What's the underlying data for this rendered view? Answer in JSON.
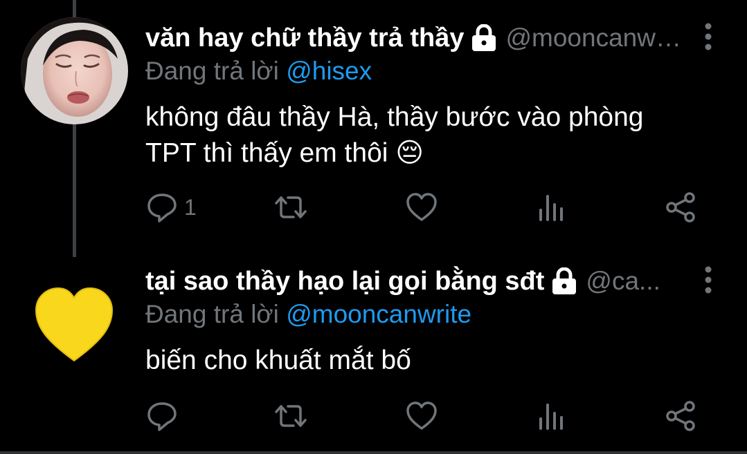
{
  "tweets": [
    {
      "display_name": "văn hay chữ thầy trả thầy",
      "handle": "@mooncanwrite",
      "reply_prefix": "Đang trả lời",
      "reply_to": "@hisex",
      "text": "không đâu thầy Hà, thầy bước vào phòng TPT thì thấy em thôi 😔",
      "reply_count": "1",
      "avatar": "crying-woman-photo",
      "protected": true
    },
    {
      "display_name": "tại sao thầy hạo lại gọi bằng sđt",
      "handle": "@ca...",
      "reply_prefix": "Đang trả lời",
      "reply_to": "@mooncanwrite",
      "text": "biến cho khuất mắt bố",
      "reply_count": "",
      "avatar": "yellow-heart-icon",
      "protected": true
    }
  ],
  "icons": {
    "reply": "reply-icon",
    "retweet": "retweet-icon",
    "like": "heart-icon",
    "views": "views-icon",
    "share": "share-icon",
    "more": "more-vertical-icon",
    "lock": "lock-icon"
  },
  "colors": {
    "background": "#000000",
    "name": "#ffffff",
    "muted": "#71767b",
    "mention": "#1d9bf0",
    "icon": "#71767b",
    "thread_line": "#3d4144",
    "heart_emoji": "#f8d71c"
  }
}
